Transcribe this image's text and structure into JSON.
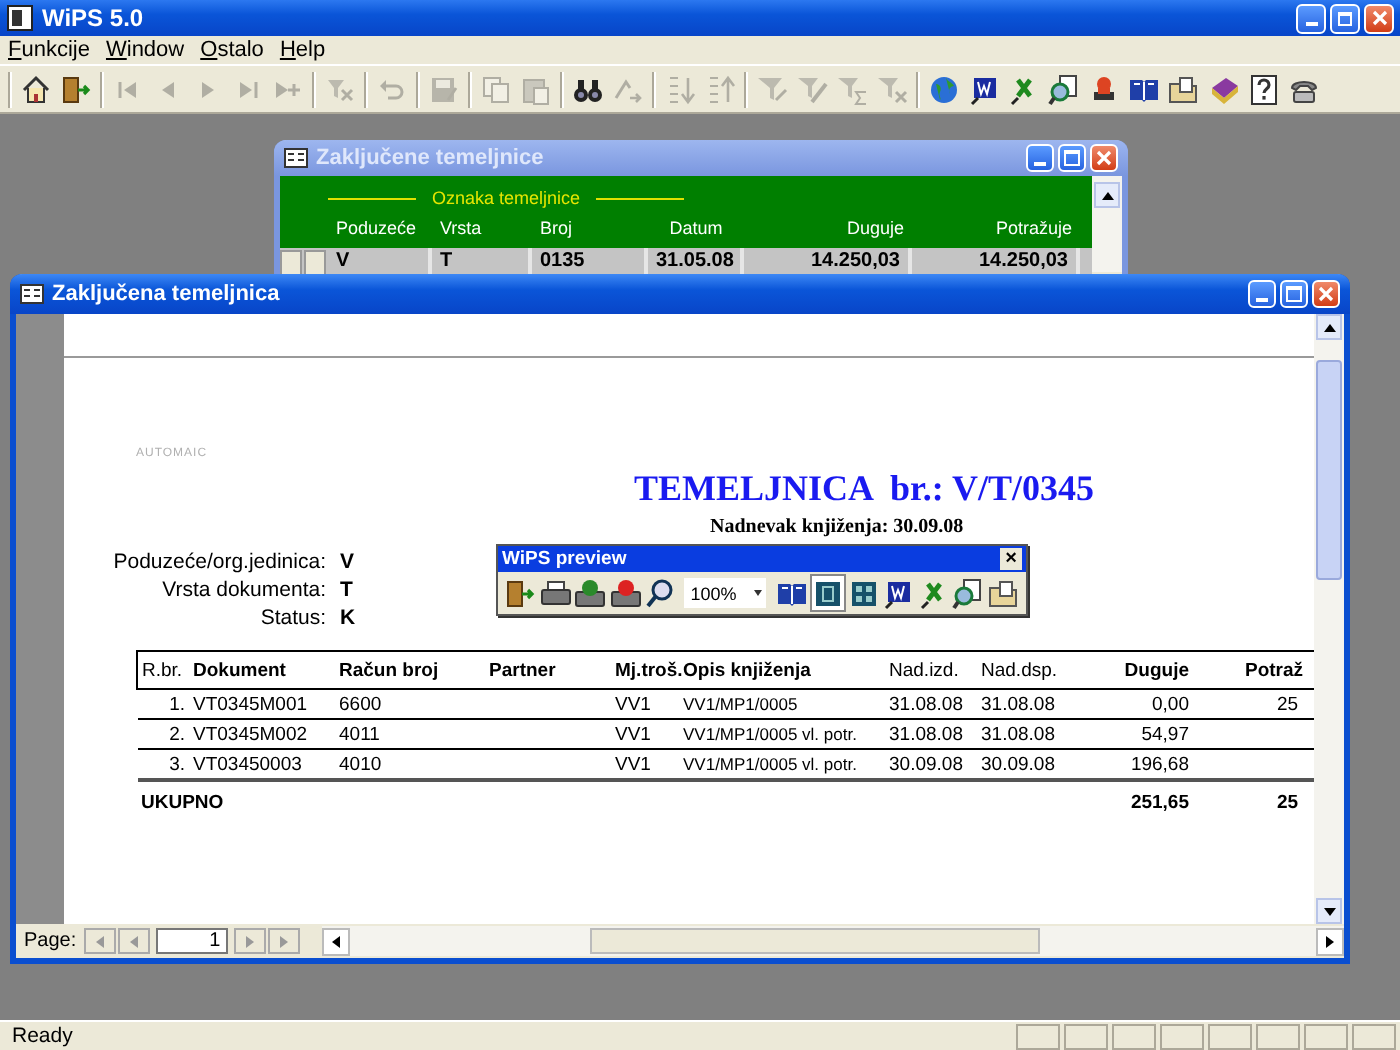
{
  "window": {
    "title": "WiPS 5.0"
  },
  "menu": [
    {
      "label": "Funkcije"
    },
    {
      "label": "Window"
    },
    {
      "label": "Ostalo"
    },
    {
      "label": "Help"
    }
  ],
  "toolbar": {
    "groups": [
      [
        {
          "disabled": false
        },
        {
          "disabled": false
        }
      ],
      [
        {
          "disabled": true
        },
        {
          "disabled": true
        },
        {
          "disabled": true
        },
        {
          "disabled": true
        },
        {
          "disabled": true
        }
      ],
      [
        {
          "disabled": true
        }
      ],
      [
        {
          "disabled": true
        }
      ],
      [
        {
          "disabled": true
        }
      ],
      [
        {
          "disabled": true
        },
        {
          "disabled": true
        }
      ],
      [
        {
          "disabled": false
        },
        {
          "disabled": true
        }
      ],
      [
        {
          "disabled": true
        },
        {
          "disabled": true
        }
      ],
      [
        {
          "disabled": true
        },
        {
          "disabled": true
        },
        {
          "disabled": true
        },
        {
          "disabled": true
        }
      ],
      [
        {
          "disabled": false
        },
        {
          "disabled": false
        },
        {
          "disabled": false
        },
        {
          "disabled": false
        },
        {
          "disabled": false
        },
        {
          "disabled": false
        },
        {
          "disabled": false
        },
        {
          "disabled": false
        },
        {
          "disabled": false
        },
        {
          "disabled": false
        }
      ]
    ]
  },
  "list_window": {
    "title": "Zaključene temeljnice",
    "active": false,
    "group_header": "Oznaka temeljnice",
    "columns": [
      {
        "label": "Poduzeće"
      },
      {
        "label": "Vrsta"
      },
      {
        "label": "Broj"
      },
      {
        "label": "Datum"
      },
      {
        "label": "Duguje"
      },
      {
        "label": "Potražuje"
      }
    ],
    "rows": [
      {
        "selected": true,
        "cells": [
          "V",
          "T",
          "0135",
          "31.05.08",
          "14.250,03",
          "14.250,03"
        ]
      }
    ]
  },
  "report_window": {
    "title": "Zaključena temeljnica",
    "active": true,
    "report": {
      "stamp": "AUTOMAIC",
      "heading": "TEMELJNICA  br.: V/T/0345",
      "date_line": "Nadnevak knjiženja: 30.09.08",
      "fields": [
        {
          "label": "Poduzeće/org.jedinica:",
          "value": "V"
        },
        {
          "label": "Vrsta dokumenta:",
          "value": "T"
        },
        {
          "label": "Status:",
          "value": "K"
        }
      ],
      "columns": [
        {
          "label": "R.br."
        },
        {
          "label": "Dokument"
        },
        {
          "label": "Račun broj"
        },
        {
          "label": "Partner"
        },
        {
          "label": "Mj.troš."
        },
        {
          "label": "Opis knjiženja"
        },
        {
          "label": "Nad.izd."
        },
        {
          "label": "Nad.dsp."
        },
        {
          "label": "Duguje"
        },
        {
          "label": "Potraž"
        }
      ],
      "rows": [
        {
          "rbr": "1.",
          "dokument": "VT0345M001",
          "racun": "6600",
          "mj": "VV1",
          "opis": "VV1/MP1/0005",
          "nad_izd": "31.08.08",
          "nad_dsp": "31.08.08",
          "duguje": "0,00",
          "column_10": "25"
        },
        {
          "rbr": "2.",
          "dokument": "VT0345M002",
          "racun": "4011",
          "mj": "VV1",
          "opis": "VV1/MP1/0005  vl. potr.",
          "nad_izd": "31.08.08",
          "nad_dsp": "31.08.08",
          "duguje": "54,97"
        },
        {
          "rbr": "3.",
          "dokument": "VT03450003",
          "racun": "4010",
          "mj": "VV1",
          "opis": "VV1/MP1/0005  vl. potr.",
          "nad_izd": "30.09.08",
          "nad_dsp": "30.09.08",
          "duguje": "196,68"
        }
      ],
      "total": {
        "label": "UKUPNO",
        "duguje": "251,65",
        "column_10": "25"
      }
    },
    "pager": {
      "label": "Page:",
      "page": "1"
    }
  },
  "preview_toolbar": {
    "title": "WiPS preview",
    "close": "×",
    "buttons": [
      {
        "kind": "button",
        "pressed": false
      },
      {
        "kind": "button",
        "pressed": false
      },
      {
        "kind": "button",
        "pressed": false
      },
      {
        "kind": "button",
        "pressed": false
      },
      {
        "kind": "button",
        "pressed": false
      },
      {
        "kind": "zoom",
        "value": "100%"
      },
      {
        "kind": "button",
        "pressed": false
      },
      {
        "kind": "button",
        "pressed": true
      },
      {
        "kind": "button",
        "pressed": false
      },
      {
        "kind": "button",
        "pressed": false
      },
      {
        "kind": "button",
        "pressed": false
      },
      {
        "kind": "button",
        "pressed": false
      },
      {
        "kind": "button",
        "pressed": false
      }
    ]
  },
  "status_bar": {
    "text": "Ready"
  }
}
